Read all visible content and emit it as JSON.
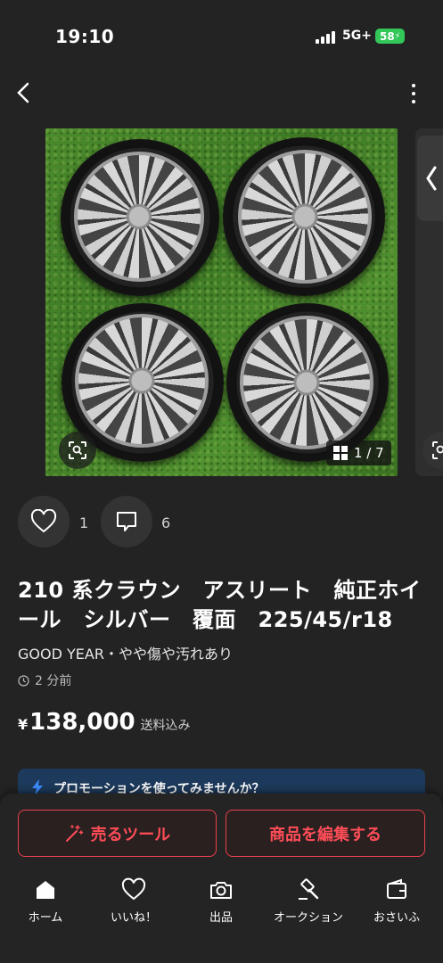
{
  "status": {
    "time": "19:10",
    "network": "5G+",
    "battery": "58"
  },
  "gallery": {
    "counter": "1 / 7"
  },
  "actions": {
    "likes": "1",
    "comments": "6"
  },
  "item": {
    "title": "210 系クラウン　アスリート　純正ホイール　シルバー　覆面　225/45/r18",
    "subtitle": "GOOD YEAR・やや傷や汚れあり",
    "posted": "2 分前",
    "price_symbol": "¥",
    "price": "138,000",
    "shipping": "送料込み"
  },
  "promo": {
    "text": "プロモーションを使ってみませんか？"
  },
  "buttons": {
    "sell_tools": "売るツール",
    "edit": "商品を編集する"
  },
  "tabs": [
    {
      "label": "ホーム",
      "icon": "home-icon"
    },
    {
      "label": "いいね！",
      "icon": "heart-icon"
    },
    {
      "label": "出品",
      "icon": "camera-icon"
    },
    {
      "label": "オークション",
      "icon": "gavel-icon"
    },
    {
      "label": "おさいふ",
      "icon": "wallet-icon"
    }
  ],
  "colors": {
    "accent": "#e9424b",
    "promo_bg": "#1d3a5c",
    "battery": "#33c759"
  }
}
